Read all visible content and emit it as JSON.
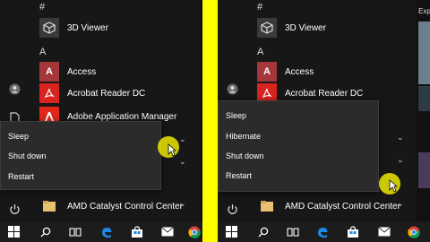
{
  "left": {
    "hash_header": "#",
    "a_header": "A",
    "apps": {
      "viewer_3d": "3D Viewer",
      "access": "Access",
      "acrobat": "Acrobat Reader DC",
      "adobe_manager": "Adobe Application Manager",
      "amd": "AMD Catalyst Control Center"
    },
    "power_menu": [
      "Sleep",
      "Shut down",
      "Restart"
    ]
  },
  "right": {
    "hash_header": "#",
    "a_header": "A",
    "apps": {
      "viewer_3d": "3D Viewer",
      "access": "Access",
      "acrobat": "Acrobat Reader DC",
      "amd": "AMD Catalyst Control Center"
    },
    "power_menu": [
      "Sleep",
      "Hibernate",
      "Shut down",
      "Restart"
    ],
    "explore_partial": "Exp"
  },
  "icons": {
    "viewer_3d": "cube-icon",
    "access": "access-icon",
    "acrobat": "acrobat-icon",
    "adobe": "adobe-icon",
    "amd": "folder-icon",
    "user": "user-icon",
    "document": "document-icon",
    "power": "power-icon",
    "start": "windows-logo-icon",
    "search": "search-icon",
    "task_view": "task-view-icon",
    "edge": "edge-icon",
    "store": "store-icon",
    "mail": "mail-icon",
    "chrome": "chrome-icon"
  },
  "colors": {
    "divider": "#ffff00",
    "menu_bg": "#171717",
    "power_menu_bg": "#2b2b2b",
    "taskbar_bg": "#1c1c1c",
    "access_red": "#a4373a",
    "acrobat_red": "#d9231f",
    "adobe_red": "#e1261c",
    "amd_folder": "#e8c170",
    "edge_blue": "#1e88e5",
    "cursor_highlight": "#ece600"
  }
}
